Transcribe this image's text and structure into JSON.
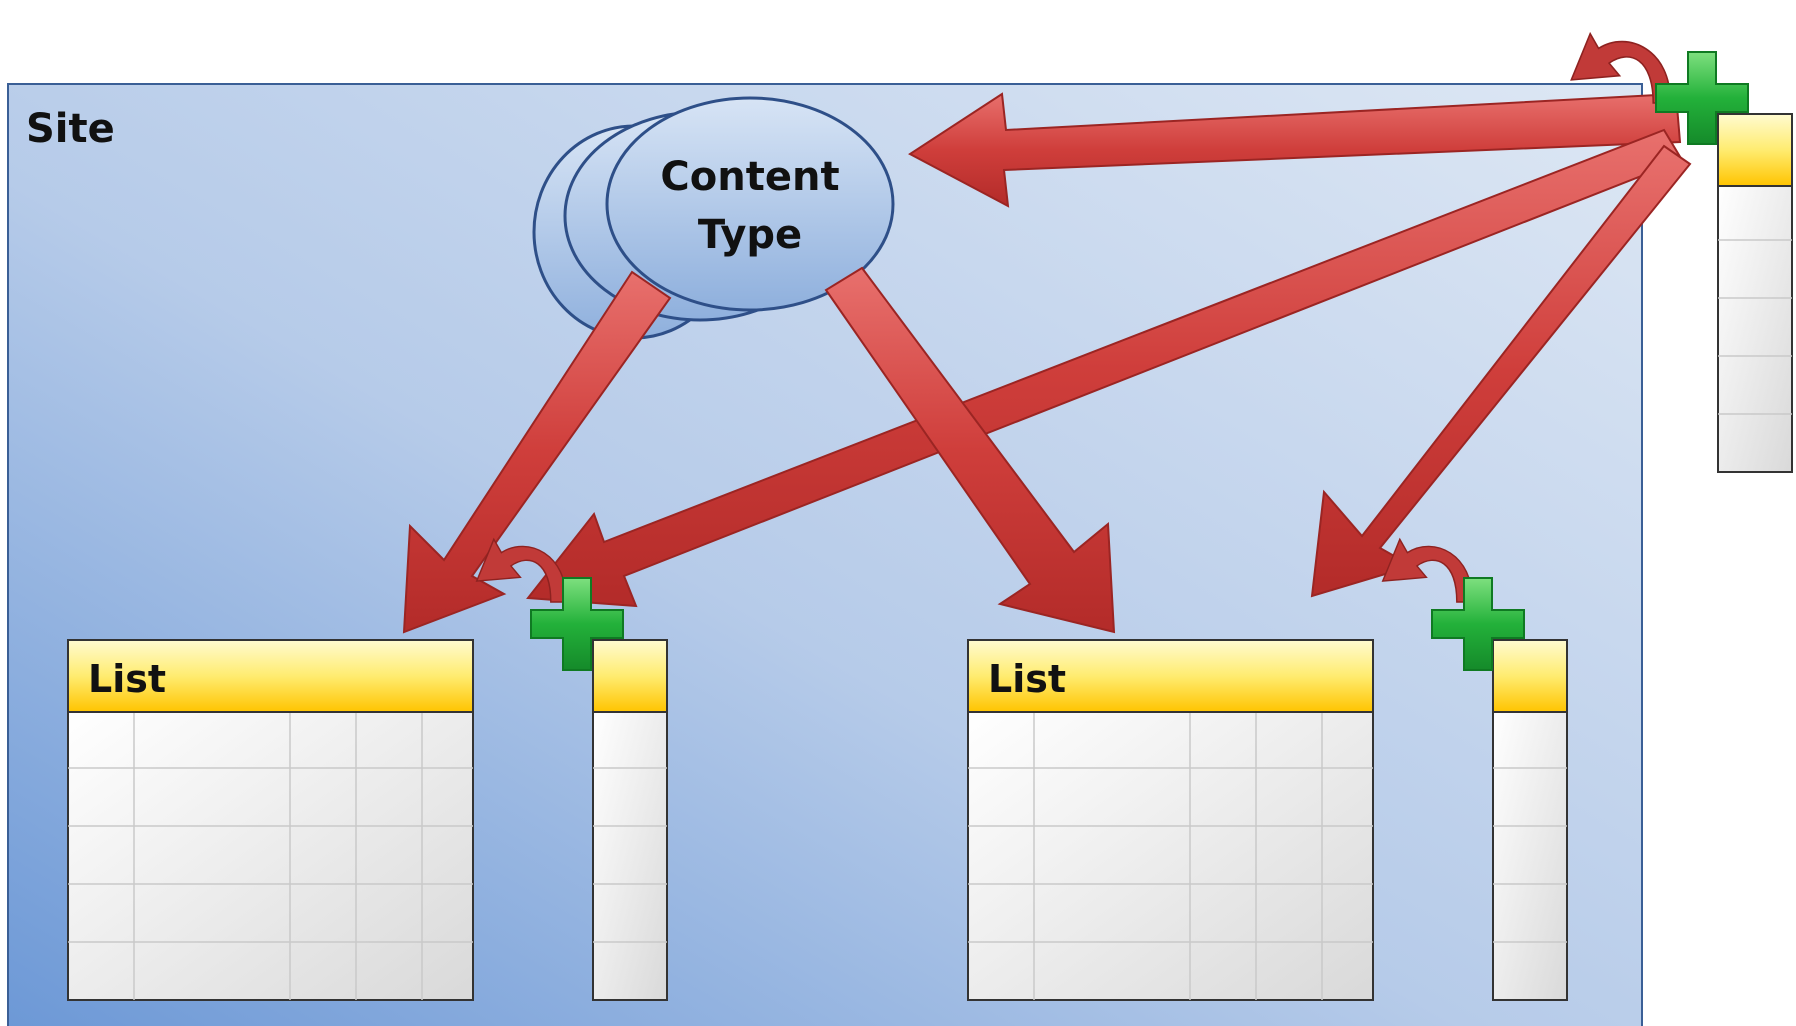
{
  "site": {
    "label": "Site"
  },
  "content_type": {
    "label_line1": "Content",
    "label_line2": "Type"
  },
  "lists": [
    {
      "label": "List"
    },
    {
      "label": "List"
    }
  ],
  "colors": {
    "site_fill_top": "#d3e0f0",
    "site_fill_bottom": "#6c98d6",
    "arrow": "#d24a48",
    "header_yellow": "#ffd320",
    "plus_green": "#27b13a",
    "ellipse_fill": "#a9c3e6",
    "ellipse_stroke": "#2e4f88"
  },
  "icons": [
    "plus-icon",
    "curved-arrow-icon",
    "column-icon"
  ]
}
